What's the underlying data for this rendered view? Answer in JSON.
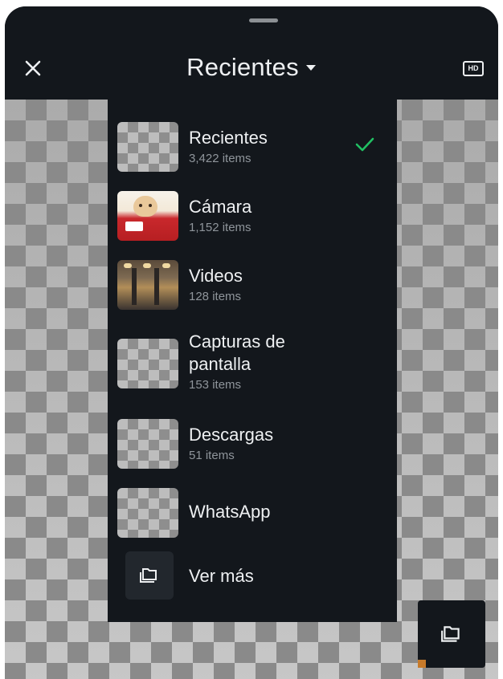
{
  "header": {
    "title": "Recientes",
    "hd_label": "HD",
    "close_icon": "close-icon",
    "dropdown_icon": "caret-down-icon"
  },
  "albums": [
    {
      "name": "Recientes",
      "count": "3,422 items",
      "selected": true,
      "thumb": "pixelated"
    },
    {
      "name": "Cámara",
      "count": "1,152 items",
      "selected": false,
      "thumb": "cat-photo"
    },
    {
      "name": "Videos",
      "count": "128 items",
      "selected": false,
      "thumb": "video-frame"
    },
    {
      "name": "Capturas de\npantalla",
      "count": "153 items",
      "selected": false,
      "thumb": "pixelated"
    },
    {
      "name": "Descargas",
      "count": "51 items",
      "selected": false,
      "thumb": "pixelated"
    },
    {
      "name": "WhatsApp",
      "count": "",
      "selected": false,
      "thumb": "pixelated"
    }
  ],
  "more": {
    "label": "Ver más",
    "icon": "folder-icon"
  },
  "colors": {
    "background": "#13171c",
    "text": "#eef0f2",
    "muted": "#8f959b",
    "check": "#21c063"
  }
}
